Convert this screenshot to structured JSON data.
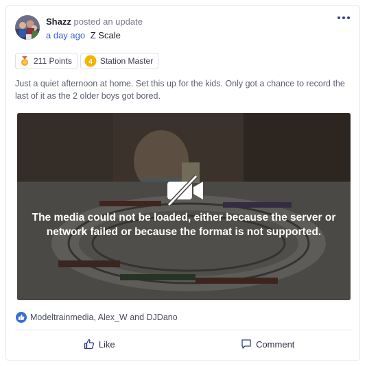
{
  "post": {
    "author": "Shazz",
    "action": "posted an update",
    "time": "a day ago",
    "group": "Z Scale",
    "more_icon": "more-dots-icon"
  },
  "badges": [
    {
      "label": "211 Points",
      "icon": "points-medal-icon",
      "color": "#f5a623"
    },
    {
      "label": "Station Master",
      "icon": "level-4-icon",
      "level": "4",
      "color": "#f5b400"
    }
  ],
  "body_text": "Just a quiet afternoon at home. Set this up for the kids. Only got a chance to record the last of it as the 2 older boys got bored.",
  "media": {
    "icon": "video-off-icon",
    "error": "The media could not be loaded, either because the server or network failed or because the format is not supported."
  },
  "reactions": {
    "icon": "like-reaction-icon",
    "text": "Modeltrainmedia, Alex_W and DJDano"
  },
  "actions": {
    "like_label": "Like",
    "comment_label": "Comment"
  },
  "colors": {
    "accent": "#385dd1",
    "like_blue": "#3a6fd8"
  }
}
